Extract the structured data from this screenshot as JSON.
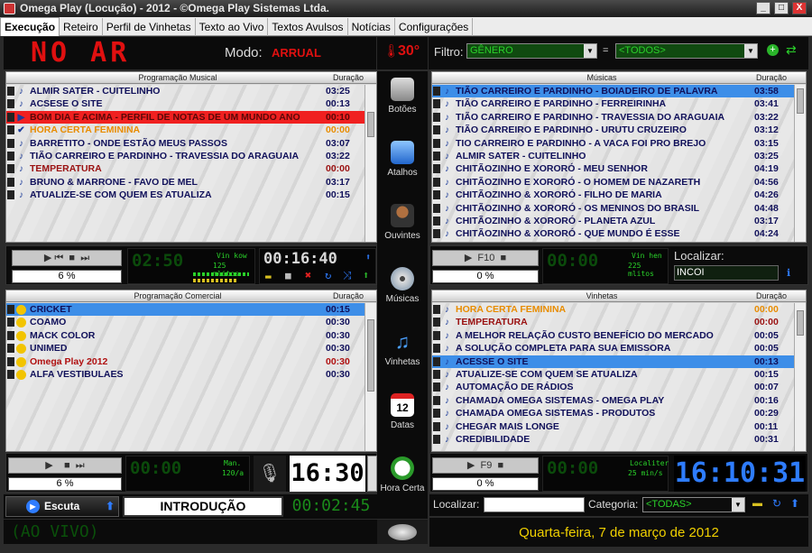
{
  "window": {
    "title": "Omega Play (Locução) - 2012 - ©Omega Play Sistemas Ltda.",
    "min": "_",
    "max": "□",
    "close": "X"
  },
  "menu": [
    "Execução",
    "Reteiro",
    "Perfil de Vinhetas",
    "Texto ao Vivo",
    "Textos Avulsos",
    "Notícias",
    "Configurações"
  ],
  "status": {
    "no_ar": "NO AR",
    "modo_label": "Modo:",
    "modo_value": "ARRUAL",
    "temperature": "30°"
  },
  "filter": {
    "label": "Filtro:",
    "field": "GÊNERO",
    "equals": "=",
    "value": "<TODOS>"
  },
  "music_panel": {
    "title": "Programação Musical",
    "duration_header": "Duração",
    "rows": [
      {
        "name": "ALMIR SATER - CUITELINHO",
        "dur": "03:25",
        "style": "normal",
        "icon": "♪"
      },
      {
        "name": "ACSESE O SITE",
        "dur": "00:13",
        "style": "normal",
        "icon": "♪"
      },
      {
        "name": "BOM DIA E ACIMA  - PERFIL DE NOTAS DE UM MUNDO ANO",
        "dur": "00:10",
        "style": "redbg",
        "icon": "▶"
      },
      {
        "name": "HORA CERTA FEMININA",
        "dur": "00:00",
        "style": "org",
        "icon": "✔"
      },
      {
        "name": "BARRETITO - ONDE ESTÃO MEUS PASSOS",
        "dur": "03:07",
        "style": "normal",
        "icon": "♪"
      },
      {
        "name": "TIÃO CARREIRO E PARDINHO - TRAVESSIA DO ARAGUAIA",
        "dur": "03:22",
        "style": "normal",
        "icon": "♪"
      },
      {
        "name": "TEMPERATURA",
        "dur": "00:00",
        "style": "dred",
        "icon": "♪"
      },
      {
        "name": "BRUNO & MARRONE - FAVO DE MEL",
        "dur": "03:17",
        "style": "normal",
        "icon": "♪"
      },
      {
        "name": "ATUALIZE-SE COM QUEM ES ATUALIZA",
        "dur": "00:15",
        "style": "normal",
        "icon": "♪"
      }
    ]
  },
  "songs_panel": {
    "title": "Músicas",
    "duration_header": "Duração",
    "rows": [
      {
        "name": "TIÃO CARREIRO E PARDINHO - BOIADEIRO DE PALAVRA",
        "dur": "03:58",
        "style": "sel"
      },
      {
        "name": "TIÃO CARREIRO E PARDINHO - FERREIRINHA",
        "dur": "03:41",
        "style": "normal"
      },
      {
        "name": "TIÃO CARREIRO E PARDINHO - TRAVESSIA DO ARAGUAIA",
        "dur": "03:22",
        "style": "normal"
      },
      {
        "name": "TIÃO CARREIRO E PARDINHO - URUTU CRUZEIRO",
        "dur": "03:12",
        "style": "normal"
      },
      {
        "name": "TIO CARREIRO  E PARDINHO - A VACA FOI PRO BREJO",
        "dur": "03:15",
        "style": "normal"
      },
      {
        "name": "ALMIR SATER - CUITELINHO",
        "dur": "03:25",
        "style": "normal"
      },
      {
        "name": "CHITÃOZINHO E  XORORÓ - MEU SENHOR",
        "dur": "04:19",
        "style": "normal"
      },
      {
        "name": "CHITÃOZINHO E  XORORÓ - O HOMEM DE NAZARETH",
        "dur": "04:56",
        "style": "normal"
      },
      {
        "name": "CHITÃOZINHO & XORORÓ - FILHO DE MARIA",
        "dur": "04:26",
        "style": "normal"
      },
      {
        "name": "CHITÃOZINHO & XORORÓ - OS MENINOS DO BRASIL",
        "dur": "04:48",
        "style": "normal"
      },
      {
        "name": "CHITÃOZINHO & XORORÓ - PLANETA AZUL",
        "dur": "03:17",
        "style": "normal"
      },
      {
        "name": "CHITÃOZINHO & XORORÓ - QUE MUNDO É ESSE",
        "dur": "04:24",
        "style": "normal"
      }
    ]
  },
  "commercial_panel": {
    "title": "Programação Comercial",
    "duration_header": "Duração",
    "rows": [
      {
        "name": "CRICKET",
        "dur": "00:15",
        "style": "sel"
      },
      {
        "name": "COAMO",
        "dur": "00:30",
        "style": "normal"
      },
      {
        "name": "MACK COLOR",
        "dur": "00:30",
        "style": "normal"
      },
      {
        "name": "UNIMED",
        "dur": "00:30",
        "style": "normal"
      },
      {
        "name": "Omega Play 2012",
        "dur": "00:30",
        "style": "mag"
      },
      {
        "name": "ALFA VESTIBULAES",
        "dur": "00:30",
        "style": "normal"
      }
    ]
  },
  "vinhetas_panel": {
    "title": "Vinhetas",
    "duration_header": "Duração",
    "rows": [
      {
        "name": "HORA CERTA FEMININA",
        "dur": "00:00",
        "style": "org"
      },
      {
        "name": "TEMPERATURA",
        "dur": "00:00",
        "style": "dred"
      },
      {
        "name": "A MELHOR RELAÇÃO CUSTO BENEFÍCIO DO MERCADO",
        "dur": "00:05",
        "style": "normal"
      },
      {
        "name": "A SOLUÇÃO COMPLETA PARA SUA EMISSORA",
        "dur": "00:05",
        "style": "normal"
      },
      {
        "name": "ACESSE O SITE",
        "dur": "00:13",
        "style": "sel"
      },
      {
        "name": "ATUALIZE-SE COM QUEM SE ATUALIZA",
        "dur": "00:15",
        "style": "normal"
      },
      {
        "name": "AUTOMAÇÃO DE RÁDIOS",
        "dur": "00:07",
        "style": "normal"
      },
      {
        "name": "CHAMADA OMEGA SISTEMAS - OMEGA PLAY",
        "dur": "00:16",
        "style": "normal"
      },
      {
        "name": "CHAMADA OMEGA SISTEMAS - PRODUTOS",
        "dur": "00:29",
        "style": "normal"
      },
      {
        "name": "CHEGAR MAIS LONGE",
        "dur": "00:11",
        "style": "normal"
      },
      {
        "name": "CREDIBILIDADE",
        "dur": "00:31",
        "style": "normal"
      }
    ]
  },
  "player1": {
    "pct": "6 %",
    "time1": "02:50",
    "vin_label": "Vin kow",
    "vin_sub": "125 mlitos",
    "time2": "00:16:40"
  },
  "player_songs": {
    "key": "F10",
    "pct": "0 %",
    "time": "00:00",
    "vin_label": "Vin hen",
    "vin_sub": "225 mlitos",
    "search_label": "Localizar:",
    "search_value": "INCOI"
  },
  "player2": {
    "pct": "6 %",
    "time": "00:00",
    "info1": "Man.",
    "info2": "120/a",
    "clock": "16:30"
  },
  "player_vin": {
    "key": "F9",
    "pct": "0 %",
    "time": "00:00",
    "info1": "Localiter",
    "info2": "25 min/s",
    "clock": "16:10:31"
  },
  "sidebar": [
    {
      "label": "Botões",
      "icon": "buttons-icon"
    },
    {
      "label": "Atalhos",
      "icon": "shortcut-icon"
    },
    {
      "label": "Ouvintes",
      "icon": "listener-icon"
    },
    {
      "label": "Músicas",
      "icon": "music-cd-icon"
    },
    {
      "label": "Vinhetas",
      "icon": "vinheta-icon"
    },
    {
      "label": "Datas",
      "icon": "calendar-icon"
    },
    {
      "label": "Hora Certa",
      "icon": "clock-icon"
    }
  ],
  "calendar_day": "12",
  "bottom": {
    "escuta": "Escuta",
    "introducao": "INTRODUÇÃO",
    "timer": "00:02:45",
    "ao_vivo": "(AO VIVO)",
    "localizar": "Localizar:",
    "categoria": "Categoria:",
    "categoria_value": "<TODAS>",
    "date": "Quarta-feira, 7 de março de 2012"
  },
  "colors": {
    "led_red": "#e01010",
    "led_green": "#2ad22a",
    "led_blue": "#2e7cff",
    "selection": "#3d8ee8",
    "date_yellow": "#f0d000"
  }
}
